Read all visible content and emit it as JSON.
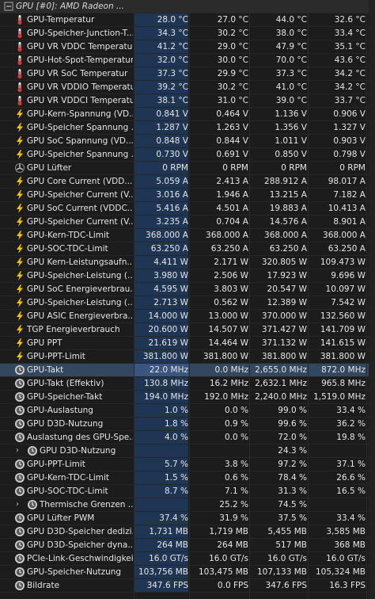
{
  "header": {
    "title": "GPU [#0]: AMD Radeon ...",
    "icon": "collapse-minus-icon"
  },
  "rows": [
    {
      "label": "GPU-Temperatur",
      "icon": "thermometer",
      "v": [
        "28.0 °C",
        "27.0 °C",
        "44.0 °C",
        "32.6 °C"
      ]
    },
    {
      "label": "GPU-Speicher-Junction-T...",
      "icon": "thermometer",
      "v": [
        "34.3 °C",
        "30.2 °C",
        "38.0 °C",
        "33.4 °C"
      ]
    },
    {
      "label": "GPU VR VDDC Temperatur",
      "icon": "thermometer",
      "v": [
        "41.2 °C",
        "29.0 °C",
        "47.9 °C",
        "35.1 °C"
      ]
    },
    {
      "label": "GPU-Hot-Spot-Temperatur",
      "icon": "thermometer",
      "v": [
        "32.0 °C",
        "30.0 °C",
        "70.0 °C",
        "43.6 °C"
      ]
    },
    {
      "label": "GPU VR SoC Temperatur",
      "icon": "thermometer",
      "v": [
        "37.3 °C",
        "29.9 °C",
        "37.3 °C",
        "34.2 °C"
      ]
    },
    {
      "label": "GPU VR VDDIO Temperatur",
      "icon": "thermometer",
      "v": [
        "39.2 °C",
        "30.2 °C",
        "41.0 °C",
        "34.2 °C"
      ]
    },
    {
      "label": "GPU VR VDDCI Temperatur",
      "icon": "thermometer",
      "v": [
        "38.1 °C",
        "31.0 °C",
        "39.0 °C",
        "33.7 °C"
      ]
    },
    {
      "label": "GPU-Kern-Spannung (VD...",
      "icon": "bolt",
      "v": [
        "0.841 V",
        "0.464 V",
        "1.136 V",
        "0.906 V"
      ]
    },
    {
      "label": "GPU-Speicher Spannung ...",
      "icon": "bolt",
      "v": [
        "1.287 V",
        "1.263 V",
        "1.356 V",
        "1.327 V"
      ]
    },
    {
      "label": "GPU SoC Spannung (VD...",
      "icon": "bolt",
      "v": [
        "0.848 V",
        "0.844 V",
        "1.011 V",
        "0.903 V"
      ]
    },
    {
      "label": "GPU-Speicher Spannung ...",
      "icon": "bolt",
      "v": [
        "0.730 V",
        "0.691 V",
        "0.850 V",
        "0.798 V"
      ]
    },
    {
      "label": "GPU Lüfter",
      "icon": "fan",
      "v": [
        "0 RPM",
        "0 RPM",
        "0 RPM",
        "0 RPM"
      ]
    },
    {
      "label": "GPU Core Current (VDD...",
      "icon": "bolt",
      "v": [
        "5.059 A",
        "2.413 A",
        "288.912 A",
        "98.017 A"
      ]
    },
    {
      "label": "GPU-Speicher Current (V...",
      "icon": "bolt",
      "v": [
        "3.016 A",
        "1.946 A",
        "13.215 A",
        "7.182 A"
      ]
    },
    {
      "label": "GPU SoC Current (VDDC...",
      "icon": "bolt",
      "v": [
        "5.416 A",
        "4.501 A",
        "19.883 A",
        "10.413 A"
      ]
    },
    {
      "label": "GPU-Speicher Current (V...",
      "icon": "bolt",
      "v": [
        "3.235 A",
        "0.704 A",
        "14.576 A",
        "8.901 A"
      ]
    },
    {
      "label": "GPU-Kern-TDC-Limit",
      "icon": "bolt",
      "v": [
        "368.000 A",
        "368.000 A",
        "368.000 A",
        "368.000 A"
      ]
    },
    {
      "label": "GPU-SOC-TDC-Limit",
      "icon": "bolt",
      "v": [
        "63.250 A",
        "63.250 A",
        "63.250 A",
        "63.250 A"
      ]
    },
    {
      "label": "GPU Kern-Leistungsaufn...",
      "icon": "bolt",
      "v": [
        "4.411 W",
        "2.171 W",
        "320.805 W",
        "109.473 W"
      ]
    },
    {
      "label": "GPU-Speicher-Leistung (...",
      "icon": "bolt",
      "v": [
        "3.980 W",
        "2.506 W",
        "17.923 W",
        "9.696 W"
      ]
    },
    {
      "label": "GPU SoC Energieverbrau...",
      "icon": "bolt",
      "v": [
        "4.595 W",
        "3.803 W",
        "20.547 W",
        "10.097 W"
      ]
    },
    {
      "label": "GPU-Speicher-Leistung (...",
      "icon": "bolt",
      "v": [
        "2.713 W",
        "0.562 W",
        "12.389 W",
        "7.542 W"
      ]
    },
    {
      "label": "GPU ASIC Energieverbra...",
      "icon": "bolt",
      "v": [
        "14.000 W",
        "13.000 W",
        "370.000 W",
        "132.560 W"
      ]
    },
    {
      "label": "TGP Energieverbrauch",
      "icon": "bolt",
      "v": [
        "20.600 W",
        "14.507 W",
        "371.427 W",
        "141.709 W"
      ]
    },
    {
      "label": "GPU PPT",
      "icon": "bolt",
      "v": [
        "21.619 W",
        "14.464 W",
        "371.132 W",
        "141.615 W"
      ]
    },
    {
      "label": "GPU-PPT-Limit",
      "icon": "bolt",
      "v": [
        "381.800 W",
        "381.800 W",
        "381.800 W",
        "381.800 W"
      ]
    },
    {
      "label": "GPU-Takt",
      "icon": "clock",
      "sel": true,
      "v": [
        "22.0 MHz",
        "0.0 MHz",
        "2,655.0 MHz",
        "872.0 MHz"
      ]
    },
    {
      "label": "GPU-Takt (Effektiv)",
      "icon": "clock",
      "v": [
        "130.8 MHz",
        "16.2 MHz",
        "2,632.1 MHz",
        "965.8 MHz"
      ]
    },
    {
      "label": "GPU-Speicher-Takt",
      "icon": "clock",
      "v": [
        "194.0 MHz",
        "192.0 MHz",
        "2,240.0 MHz",
        "1,519.0 MHz"
      ]
    },
    {
      "label": "GPU-Auslastung",
      "icon": "clock",
      "v": [
        "1.0 %",
        "0.0 %",
        "99.0 %",
        "33.4 %"
      ]
    },
    {
      "label": "GPU D3D-Nutzung",
      "icon": "clock",
      "v": [
        "1.8 %",
        "0.9 %",
        "99.6 %",
        "36.2 %"
      ]
    },
    {
      "label": "Auslastung des GPU-Spe...",
      "icon": "clock",
      "v": [
        "4.0 %",
        "0.0 %",
        "72.0 %",
        "19.8 %"
      ]
    },
    {
      "label": "GPU D3D-Nutzung",
      "icon": "clock",
      "sub": true,
      "v": [
        "",
        "",
        "24.3 %",
        ""
      ]
    },
    {
      "label": "GPU-PPT-Limit",
      "icon": "clock",
      "v": [
        "5.7 %",
        "3.8 %",
        "97.2 %",
        "37.1 %"
      ]
    },
    {
      "label": "GPU-Kern-TDC-Limit",
      "icon": "clock",
      "v": [
        "1.5 %",
        "0.6 %",
        "78.4 %",
        "26.6 %"
      ]
    },
    {
      "label": "GPU-SOC-TDC-Limit",
      "icon": "clock",
      "v": [
        "8.7 %",
        "7.1 %",
        "31.3 %",
        "16.5 %"
      ]
    },
    {
      "label": "Thermische Grenzen ...",
      "icon": "clock",
      "sub": true,
      "v": [
        "",
        "25.2 %",
        "74.5 %",
        ""
      ]
    },
    {
      "label": "GPU Lüfter PWM",
      "icon": "clock",
      "v": [
        "37.4 %",
        "31.9 %",
        "37.5 %",
        "33.4 %"
      ]
    },
    {
      "label": "GPU D3D-Speicher dedizi...",
      "icon": "clock",
      "v": [
        "1,731 MB",
        "1,719 MB",
        "5,455 MB",
        "3,585 MB"
      ]
    },
    {
      "label": "GPU D3D-Speicher dyna...",
      "icon": "clock",
      "v": [
        "264 MB",
        "264 MB",
        "517 MB",
        "368 MB"
      ]
    },
    {
      "label": "PCIe-Link-Geschwindigkeit",
      "icon": "clock",
      "v": [
        "16.0 GT/s",
        "16.0 GT/s",
        "16.0 GT/s",
        "16.0 GT/s"
      ]
    },
    {
      "label": "GPU-Speicher-Nutzung",
      "icon": "clock",
      "v": [
        "103,756 MB",
        "103,475 MB",
        "107,133 MB",
        "105,324 MB"
      ]
    },
    {
      "label": "Bildrate",
      "icon": "clock",
      "v": [
        "347.6 FPS",
        "0.0 FPS",
        "347.6 FPS",
        "16.3 FPS"
      ]
    }
  ]
}
